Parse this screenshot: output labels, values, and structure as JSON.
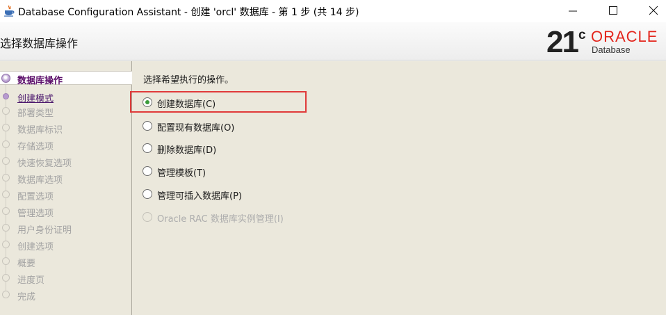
{
  "window": {
    "title": "Database Configuration Assistant - 创建 'orcl' 数据库 - 第 1 步 (共 14 步)"
  },
  "header": {
    "page_title": "选择数据库操作",
    "logo_version": "21",
    "logo_superscript": "c",
    "logo_brand": "ORACLE",
    "logo_product": "Database"
  },
  "steps": [
    {
      "label": "数据库操作",
      "state": "active"
    },
    {
      "label": "创建模式",
      "state": "link"
    },
    {
      "label": "部署类型",
      "state": "disabled"
    },
    {
      "label": "数据库标识",
      "state": "disabled"
    },
    {
      "label": "存储选项",
      "state": "disabled"
    },
    {
      "label": "快速恢复选项",
      "state": "disabled"
    },
    {
      "label": "数据库选项",
      "state": "disabled"
    },
    {
      "label": "配置选项",
      "state": "disabled"
    },
    {
      "label": "管理选项",
      "state": "disabled"
    },
    {
      "label": "用户身份证明",
      "state": "disabled"
    },
    {
      "label": "创建选项",
      "state": "disabled"
    },
    {
      "label": "概要",
      "state": "disabled"
    },
    {
      "label": "进度页",
      "state": "disabled"
    },
    {
      "label": "完成",
      "state": "disabled"
    }
  ],
  "main": {
    "instruction": "选择希望执行的操作。",
    "options": [
      {
        "label": "创建数据库(C)",
        "checked": true,
        "enabled": true
      },
      {
        "label": "配置现有数据库(O)",
        "checked": false,
        "enabled": true
      },
      {
        "label": "删除数据库(D)",
        "checked": false,
        "enabled": true
      },
      {
        "label": "管理模板(T)",
        "checked": false,
        "enabled": true
      },
      {
        "label": "管理可插入数据库(P)",
        "checked": false,
        "enabled": true
      },
      {
        "label": "Oracle RAC 数据库实例管理(I)",
        "checked": false,
        "enabled": false
      }
    ]
  },
  "colors": {
    "highlight": "#e03a3a",
    "brand_red": "#e3261d",
    "panel_bg": "#ebe8dc",
    "active_step": "#5c0f6a"
  }
}
